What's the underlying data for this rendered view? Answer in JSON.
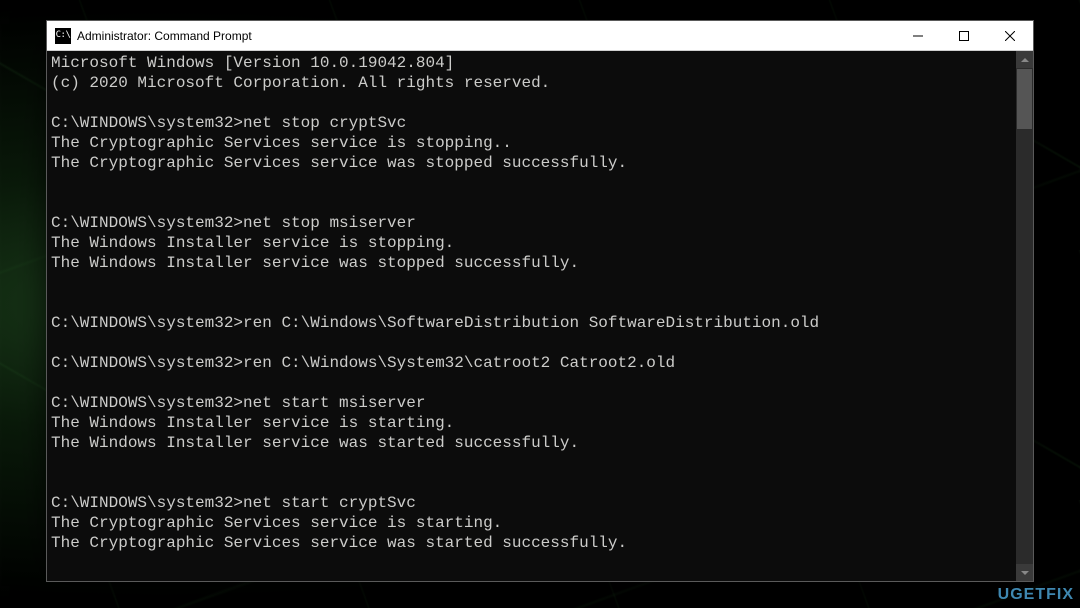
{
  "window": {
    "title": "Administrator: Command Prompt",
    "icon_label": "C:\\"
  },
  "console": {
    "lines": [
      "Microsoft Windows [Version 10.0.19042.804]",
      "(c) 2020 Microsoft Corporation. All rights reserved.",
      "",
      "C:\\WINDOWS\\system32>net stop cryptSvc",
      "The Cryptographic Services service is stopping..",
      "The Cryptographic Services service was stopped successfully.",
      "",
      "",
      "C:\\WINDOWS\\system32>net stop msiserver",
      "The Windows Installer service is stopping.",
      "The Windows Installer service was stopped successfully.",
      "",
      "",
      "C:\\WINDOWS\\system32>ren C:\\Windows\\SoftwareDistribution SoftwareDistribution.old",
      "",
      "C:\\WINDOWS\\system32>ren C:\\Windows\\System32\\catroot2 Catroot2.old",
      "",
      "C:\\WINDOWS\\system32>net start msiserver",
      "The Windows Installer service is starting.",
      "The Windows Installer service was started successfully.",
      "",
      "",
      "C:\\WINDOWS\\system32>net start cryptSvc",
      "The Cryptographic Services service is starting.",
      "The Cryptographic Services service was started successfully."
    ]
  },
  "watermark": "UGETFIX"
}
